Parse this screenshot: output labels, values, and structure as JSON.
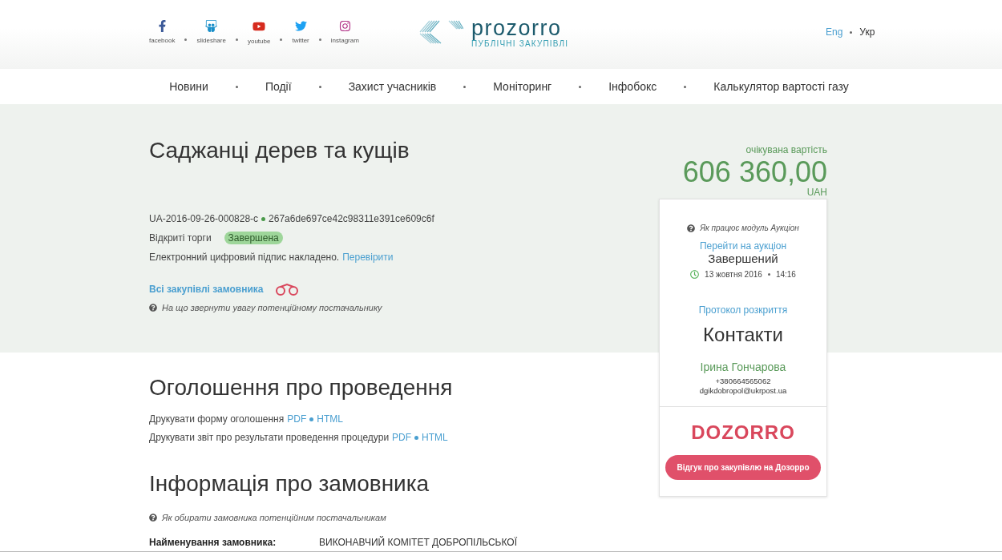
{
  "social": [
    {
      "kind": "facebook",
      "label": "facebook"
    },
    {
      "kind": "slideshare",
      "label": "slideshare"
    },
    {
      "kind": "youtube",
      "label": "youtube"
    },
    {
      "kind": "twitter",
      "label": "twitter"
    },
    {
      "kind": "instagram",
      "label": "instagram"
    }
  ],
  "logo": {
    "name": "prozorro",
    "tagline": "ПУБЛІЧНІ ЗАКУПІВЛІ"
  },
  "languages": [
    {
      "label": "Eng",
      "selected": false
    },
    {
      "label": "Укр",
      "selected": true
    }
  ],
  "nav": [
    "Новини",
    "Події",
    "Захист учасників",
    "Моніторинг",
    "Інфобокс",
    "Калькулятор вартості газу"
  ],
  "tender": {
    "title": "Саджанці дерев та кущів",
    "id": "UA-2016-09-26-000828-c",
    "hash": "267a6de697ce42c98311e391ce609c6f",
    "procedure": "Відкриті торги",
    "status": "Завершена",
    "signature": "Електронний цифровий підпис накладено.",
    "signature_link": "Перевірити",
    "all_purchases": "Всі закупівлі замовника",
    "hint": "На що звернути увагу потенційному постачальнику"
  },
  "price": {
    "label": "очікувана вартість",
    "amount": "606 360,00",
    "currency": "UAH"
  },
  "auction": {
    "help": "Як працює модуль Аукціон",
    "link": "Перейти на аукціон",
    "status": "Завершений",
    "date": "13 жовтня 2016",
    "time": "14:16",
    "protocol": "Протокол розкриття"
  },
  "contacts": {
    "title": "Контакти",
    "name": "Ірина Гончарова",
    "phone": "+380664565062",
    "email": "dgikdobropol@ukrpost.ua"
  },
  "dozorro": {
    "logo": "DOZORRO",
    "button": "Відгук про закупівлю на Дозорро"
  },
  "announcement": {
    "title": "Оголошення про проведення",
    "rows": [
      {
        "label": "Друкувати форму оголошення",
        "links": [
          "PDF",
          "HTML"
        ]
      },
      {
        "label": "Друкувати звіт про результати проведення процедури",
        "links": [
          "PDF",
          "HTML"
        ]
      }
    ]
  },
  "customer": {
    "title": "Інформація про замовника",
    "hint": "Як обирати замовника потенційним постачальникам",
    "fields": [
      {
        "label": "Найменування замовника:",
        "value": "ВИКОНАВЧИЙ КОМІТЕТ ДОБРОПІЛЬСЬКОЇ"
      }
    ]
  }
}
